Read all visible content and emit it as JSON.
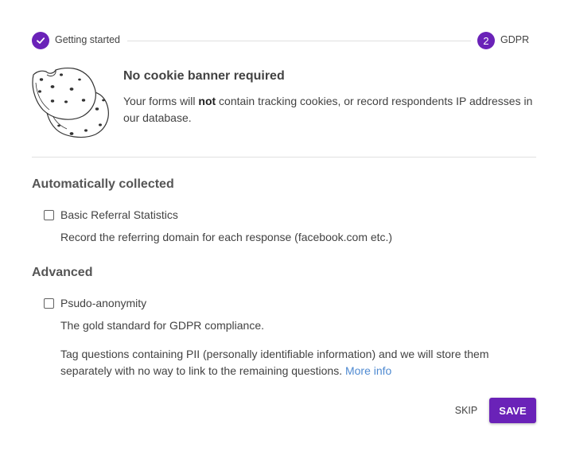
{
  "stepper": {
    "steps": [
      {
        "number": "",
        "label": "Getting started",
        "state": "completed",
        "icon": "check-icon"
      },
      {
        "number": "2",
        "label": "GDPR",
        "state": "active"
      }
    ]
  },
  "banner": {
    "title": "No cookie banner required",
    "desc_before": "Your forms will ",
    "desc_bold": "not",
    "desc_after": " contain tracking cookies, or record respondents IP addresses in our database.",
    "illustration": "cookies-illustration"
  },
  "sections": [
    {
      "title": "Automatically collected",
      "options": [
        {
          "label": "Basic Referral Statistics",
          "checked": false,
          "help": "Record the referring domain for each response (facebook.com etc.)"
        }
      ]
    },
    {
      "title": "Advanced",
      "options": [
        {
          "label": "Psudo-anonymity",
          "checked": false,
          "help": "The gold standard for GDPR compliance.",
          "help2": "Tag questions containing PII (personally identifiable information) and we will store them separately with no way to link to the remaining questions. ",
          "link": "More info"
        }
      ]
    }
  ],
  "actions": {
    "skip": "SKIP",
    "save": "SAVE"
  },
  "colors": {
    "accent": "#6a22b8",
    "link": "#4f8ad1"
  }
}
